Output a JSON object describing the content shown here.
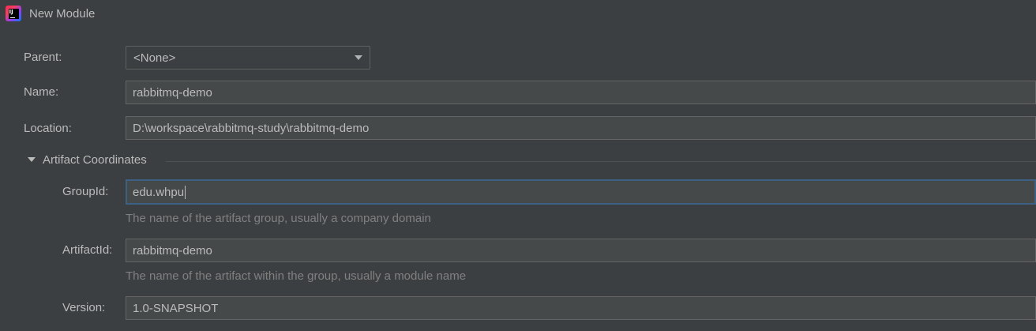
{
  "window": {
    "title": "New Module",
    "logo_icon": "intellij-idea-icon"
  },
  "form": {
    "parent": {
      "label": "Parent:",
      "value": "<None>"
    },
    "name": {
      "label": "Name:",
      "value": "rabbitmq-demo"
    },
    "location": {
      "label": "Location:",
      "value": "D:\\workspace\\rabbitmq-study\\rabbitmq-demo"
    }
  },
  "artifact": {
    "section_title": "Artifact Coordinates",
    "expanded": true,
    "group_id": {
      "label": "GroupId:",
      "value": "edu.whpu",
      "hint": "The name of the artifact group, usually a company domain"
    },
    "artifact_id": {
      "label": "ArtifactId:",
      "value": "rabbitmq-demo",
      "hint": "The name of the artifact within the group, usually a module name"
    },
    "version": {
      "label": "Version:",
      "value": "1.0-SNAPSHOT"
    }
  },
  "colors": {
    "background": "#3c3f41",
    "field_background": "#45494a",
    "focus_border": "#3d6185",
    "text": "#bbbbbb",
    "hint_text": "#808080"
  }
}
